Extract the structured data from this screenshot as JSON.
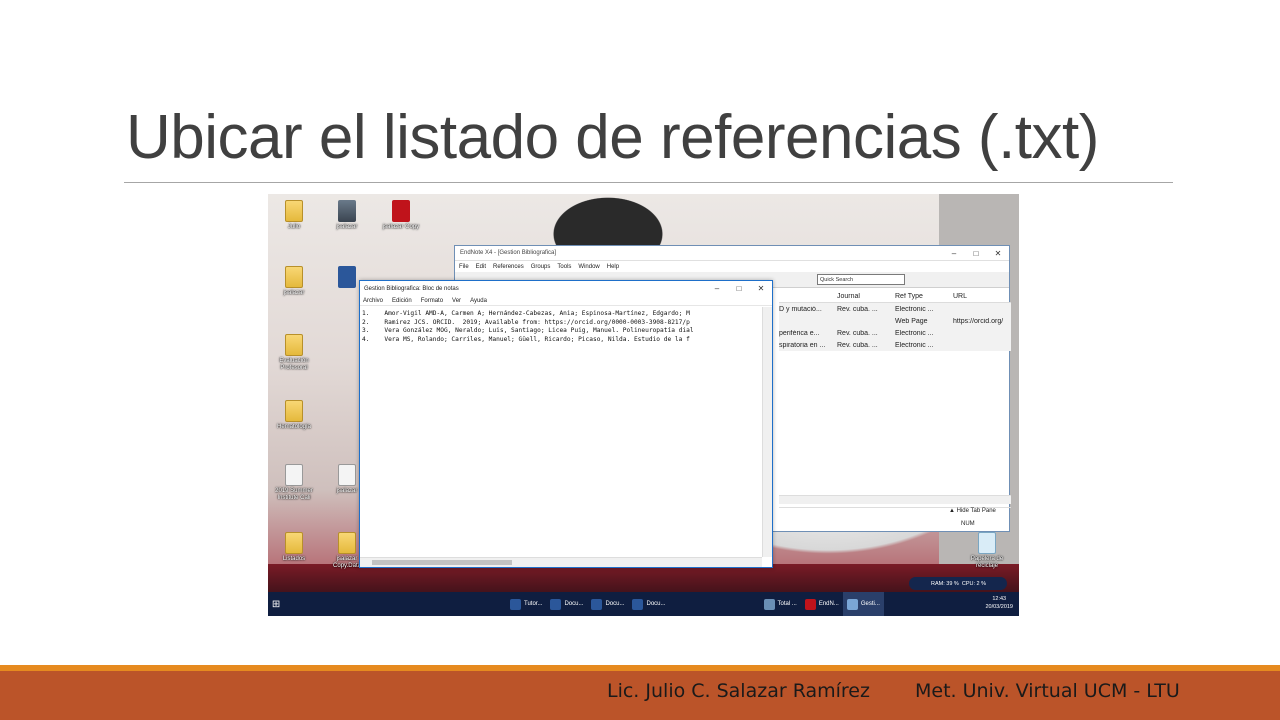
{
  "slide": {
    "title": "Ubicar el listado de referencias (.txt)",
    "footer_author": "Lic. Julio C. Salazar Ramírez",
    "footer_course": "Met. Univ. Virtual UCM - LTU",
    "accent_orange": "#e68a1f",
    "accent_rust": "#bb5429"
  },
  "desktop_icons": [
    {
      "label": "Julio",
      "icon": "folder-icon"
    },
    {
      "label": "jsalazar",
      "icon": "user-photo-icon"
    },
    {
      "label": "jsalazar Copy",
      "icon": "endnote-library-icon"
    },
    {
      "label": "jsalazar",
      "icon": "folder-icon"
    },
    {
      "label": "Evaluación Profesoral",
      "icon": "folder-icon"
    },
    {
      "label": "Hematología",
      "icon": "folder-icon"
    },
    {
      "label": "2019 Summer Institute Cali",
      "icon": "document-icon"
    },
    {
      "label": "jsalazar",
      "icon": "document-icon"
    },
    {
      "label": "Listados",
      "icon": "folder-icon"
    },
    {
      "label": "jsalazar Copy.Data",
      "icon": "folder-icon"
    },
    {
      "label": "Papelera de reciclaje",
      "icon": "recycle-bin-icon"
    }
  ],
  "endnote": {
    "title": "EndNote X4 - [Gestion Bibliografica]",
    "menu": [
      "File",
      "Edit",
      "References",
      "Groups",
      "Tools",
      "Window",
      "Help"
    ],
    "quick_search": "Quick Search",
    "columns": [
      "",
      "Journal",
      "Ref Type",
      "URL"
    ],
    "rows": [
      [
        "D y mutació...",
        "Rev. cuba. ...",
        "Electronic ...",
        ""
      ],
      [
        "",
        "",
        "Web Page",
        "https://orcid.org/"
      ],
      [
        "periférica e...",
        "Rev. cuba. ...",
        "Electronic ...",
        ""
      ],
      [
        "spiratoria en ...",
        "Rev. cuba. ...",
        "Electronic ...",
        ""
      ]
    ],
    "hide_tab_pane": "Hide Tab Pane",
    "status_num": "NUM"
  },
  "notepad": {
    "title": "Gestion Bibliografica: Bloc de notas",
    "menu": [
      "Archivo",
      "Edición",
      "Formato",
      "Ver",
      "Ayuda"
    ],
    "content": "1.\tAmor-Vigil AMD-A, Carmen A; Hernández-Cabezas, Ania; Espinosa-Martínez, Edgardo; M\n2.\tRamirez JCS. ORCID.  2019; Available from: https://orcid.org/0000-0003-3908-8217/p\n3.\tVera González MOG, Neraldo; Luis, Santiago; Licea Puig, Manuel. Polineuropatía dial\n4.\tVera MS, Rolando; Carriles, Manuel; Güell, Ricardo; Picaso, Nilda. Estudio de la f"
  },
  "taskbar": {
    "items": [
      {
        "label": "Tutor...",
        "icon": "word-icon",
        "color": "#2b579a"
      },
      {
        "label": "Docu...",
        "icon": "word-icon",
        "color": "#2b579a"
      },
      {
        "label": "Docu...",
        "icon": "word-icon",
        "color": "#2b579a"
      },
      {
        "label": "Docu...",
        "icon": "word-icon",
        "color": "#2b579a"
      },
      {
        "label": "Total ...",
        "icon": "total-commander-icon",
        "color": "#6a8fb5"
      },
      {
        "label": "EndN...",
        "icon": "endnote-icon",
        "color": "#c0131b"
      },
      {
        "label": "Gesti...",
        "icon": "notepad-icon",
        "color": "#7aa6d6"
      }
    ],
    "ram": "RAM: 39 %",
    "cpu": "CPU: 2 %",
    "time": "12:43",
    "date": "20/03/2019"
  }
}
